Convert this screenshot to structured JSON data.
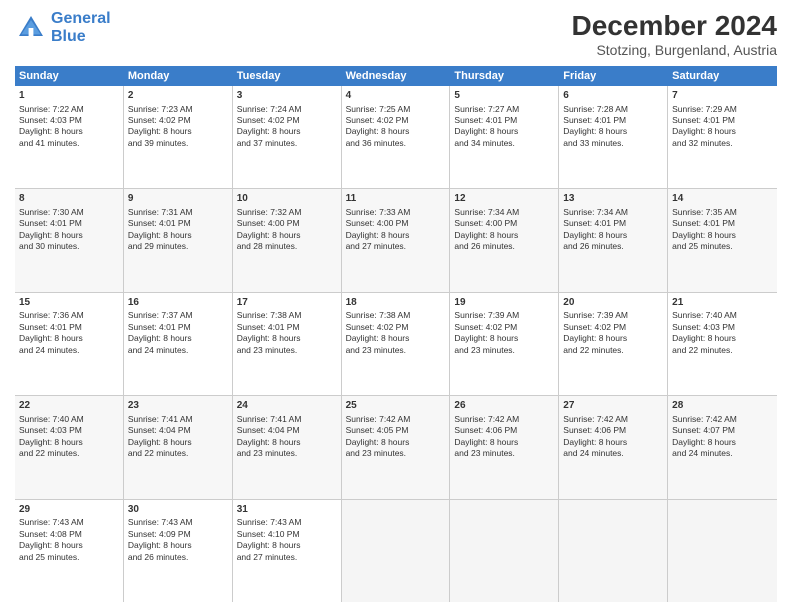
{
  "logo": {
    "line1": "General",
    "line2": "Blue"
  },
  "title": "December 2024",
  "subtitle": "Stotzing, Burgenland, Austria",
  "header_days": [
    "Sunday",
    "Monday",
    "Tuesday",
    "Wednesday",
    "Thursday",
    "Friday",
    "Saturday"
  ],
  "weeks": [
    [
      {
        "day": "1",
        "lines": [
          "Sunrise: 7:22 AM",
          "Sunset: 4:03 PM",
          "Daylight: 8 hours",
          "and 41 minutes."
        ]
      },
      {
        "day": "2",
        "lines": [
          "Sunrise: 7:23 AM",
          "Sunset: 4:02 PM",
          "Daylight: 8 hours",
          "and 39 minutes."
        ]
      },
      {
        "day": "3",
        "lines": [
          "Sunrise: 7:24 AM",
          "Sunset: 4:02 PM",
          "Daylight: 8 hours",
          "and 37 minutes."
        ]
      },
      {
        "day": "4",
        "lines": [
          "Sunrise: 7:25 AM",
          "Sunset: 4:02 PM",
          "Daylight: 8 hours",
          "and 36 minutes."
        ]
      },
      {
        "day": "5",
        "lines": [
          "Sunrise: 7:27 AM",
          "Sunset: 4:01 PM",
          "Daylight: 8 hours",
          "and 34 minutes."
        ]
      },
      {
        "day": "6",
        "lines": [
          "Sunrise: 7:28 AM",
          "Sunset: 4:01 PM",
          "Daylight: 8 hours",
          "and 33 minutes."
        ]
      },
      {
        "day": "7",
        "lines": [
          "Sunrise: 7:29 AM",
          "Sunset: 4:01 PM",
          "Daylight: 8 hours",
          "and 32 minutes."
        ]
      }
    ],
    [
      {
        "day": "8",
        "lines": [
          "Sunrise: 7:30 AM",
          "Sunset: 4:01 PM",
          "Daylight: 8 hours",
          "and 30 minutes."
        ]
      },
      {
        "day": "9",
        "lines": [
          "Sunrise: 7:31 AM",
          "Sunset: 4:01 PM",
          "Daylight: 8 hours",
          "and 29 minutes."
        ]
      },
      {
        "day": "10",
        "lines": [
          "Sunrise: 7:32 AM",
          "Sunset: 4:00 PM",
          "Daylight: 8 hours",
          "and 28 minutes."
        ]
      },
      {
        "day": "11",
        "lines": [
          "Sunrise: 7:33 AM",
          "Sunset: 4:00 PM",
          "Daylight: 8 hours",
          "and 27 minutes."
        ]
      },
      {
        "day": "12",
        "lines": [
          "Sunrise: 7:34 AM",
          "Sunset: 4:00 PM",
          "Daylight: 8 hours",
          "and 26 minutes."
        ]
      },
      {
        "day": "13",
        "lines": [
          "Sunrise: 7:34 AM",
          "Sunset: 4:01 PM",
          "Daylight: 8 hours",
          "and 26 minutes."
        ]
      },
      {
        "day": "14",
        "lines": [
          "Sunrise: 7:35 AM",
          "Sunset: 4:01 PM",
          "Daylight: 8 hours",
          "and 25 minutes."
        ]
      }
    ],
    [
      {
        "day": "15",
        "lines": [
          "Sunrise: 7:36 AM",
          "Sunset: 4:01 PM",
          "Daylight: 8 hours",
          "and 24 minutes."
        ]
      },
      {
        "day": "16",
        "lines": [
          "Sunrise: 7:37 AM",
          "Sunset: 4:01 PM",
          "Daylight: 8 hours",
          "and 24 minutes."
        ]
      },
      {
        "day": "17",
        "lines": [
          "Sunrise: 7:38 AM",
          "Sunset: 4:01 PM",
          "Daylight: 8 hours",
          "and 23 minutes."
        ]
      },
      {
        "day": "18",
        "lines": [
          "Sunrise: 7:38 AM",
          "Sunset: 4:02 PM",
          "Daylight: 8 hours",
          "and 23 minutes."
        ]
      },
      {
        "day": "19",
        "lines": [
          "Sunrise: 7:39 AM",
          "Sunset: 4:02 PM",
          "Daylight: 8 hours",
          "and 23 minutes."
        ]
      },
      {
        "day": "20",
        "lines": [
          "Sunrise: 7:39 AM",
          "Sunset: 4:02 PM",
          "Daylight: 8 hours",
          "and 22 minutes."
        ]
      },
      {
        "day": "21",
        "lines": [
          "Sunrise: 7:40 AM",
          "Sunset: 4:03 PM",
          "Daylight: 8 hours",
          "and 22 minutes."
        ]
      }
    ],
    [
      {
        "day": "22",
        "lines": [
          "Sunrise: 7:40 AM",
          "Sunset: 4:03 PM",
          "Daylight: 8 hours",
          "and 22 minutes."
        ]
      },
      {
        "day": "23",
        "lines": [
          "Sunrise: 7:41 AM",
          "Sunset: 4:04 PM",
          "Daylight: 8 hours",
          "and 22 minutes."
        ]
      },
      {
        "day": "24",
        "lines": [
          "Sunrise: 7:41 AM",
          "Sunset: 4:04 PM",
          "Daylight: 8 hours",
          "and 23 minutes."
        ]
      },
      {
        "day": "25",
        "lines": [
          "Sunrise: 7:42 AM",
          "Sunset: 4:05 PM",
          "Daylight: 8 hours",
          "and 23 minutes."
        ]
      },
      {
        "day": "26",
        "lines": [
          "Sunrise: 7:42 AM",
          "Sunset: 4:06 PM",
          "Daylight: 8 hours",
          "and 23 minutes."
        ]
      },
      {
        "day": "27",
        "lines": [
          "Sunrise: 7:42 AM",
          "Sunset: 4:06 PM",
          "Daylight: 8 hours",
          "and 24 minutes."
        ]
      },
      {
        "day": "28",
        "lines": [
          "Sunrise: 7:42 AM",
          "Sunset: 4:07 PM",
          "Daylight: 8 hours",
          "and 24 minutes."
        ]
      }
    ],
    [
      {
        "day": "29",
        "lines": [
          "Sunrise: 7:43 AM",
          "Sunset: 4:08 PM",
          "Daylight: 8 hours",
          "and 25 minutes."
        ]
      },
      {
        "day": "30",
        "lines": [
          "Sunrise: 7:43 AM",
          "Sunset: 4:09 PM",
          "Daylight: 8 hours",
          "and 26 minutes."
        ]
      },
      {
        "day": "31",
        "lines": [
          "Sunrise: 7:43 AM",
          "Sunset: 4:10 PM",
          "Daylight: 8 hours",
          "and 27 minutes."
        ]
      },
      {
        "day": "",
        "lines": []
      },
      {
        "day": "",
        "lines": []
      },
      {
        "day": "",
        "lines": []
      },
      {
        "day": "",
        "lines": []
      }
    ]
  ]
}
